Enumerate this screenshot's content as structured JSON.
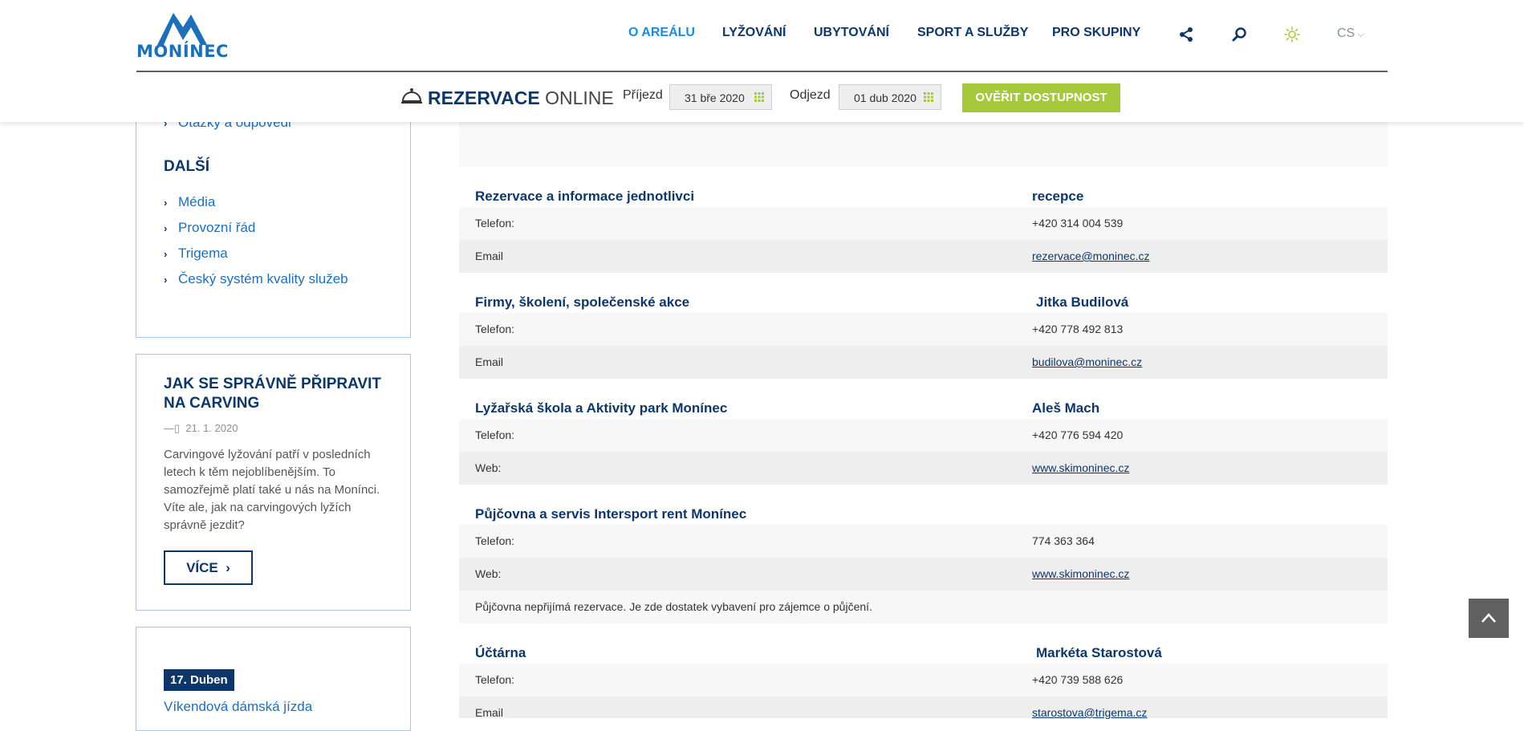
{
  "logo": {
    "text": "MONÍNEC"
  },
  "nav": {
    "items": [
      {
        "label": "O AREÁLU",
        "active": true
      },
      {
        "label": "LYŽOVÁNÍ"
      },
      {
        "label": "UBYTOVÁNÍ"
      },
      {
        "label": "SPORT A SLUŽBY"
      },
      {
        "label": "PRO SKUPINY"
      }
    ],
    "icons": [
      "share-icon",
      "search-icon",
      "sun-icon"
    ],
    "language": "CS"
  },
  "reservation": {
    "title_bold": "REZERVACE",
    "title_light": "ONLINE",
    "arrival_label": "Příjezd",
    "arrival_value": "31 bře 2020",
    "departure_label": "Odjezd",
    "departure_value": "01 dub 2020",
    "check_button": "OVĚŘIT DOSTUPNOST"
  },
  "sidebar": {
    "partial_link": "Otázky a odpovědi",
    "heading": "DALŠÍ",
    "links": [
      "Média",
      "Provozní řád",
      "Trigema",
      "Český systém kvality služeb"
    ],
    "article": {
      "title": "JAK SE SPRÁVNĚ PŘIPRAVIT NA CARVING",
      "date_prefix": "—▯",
      "date": "21. 1. 2020",
      "text": "Carvingové lyžování patří v posledních letech k těm nejoblíbenějším. To samozřejmě platí také u nás na Monínci. Víte ale, jak na carvingových lyžích správně jezdit?",
      "button": "VÍCE"
    },
    "event": {
      "badge": "17. Duben",
      "title": "Víkendová dámská jízda"
    }
  },
  "contacts": [
    {
      "title": "Rezervace a informace jednotlivci",
      "person": "recepce",
      "rows": [
        {
          "label": "Telefon:",
          "value": "+420 314 004 539"
        },
        {
          "label": "Email",
          "value": "rezervace@moninec.cz",
          "link": true
        }
      ]
    },
    {
      "title": "Firmy, školení, společenské akce",
      "person": "Jitka Budilová",
      "rows": [
        {
          "label": "Telefon:",
          "value": "+420 778 492 813"
        },
        {
          "label": "Email",
          "value": "budilova@moninec.cz",
          "link": true
        }
      ]
    },
    {
      "title": "Lyžařská škola a Aktivity park Monínec",
      "person": "Aleš Mach",
      "rows": [
        {
          "label": "Telefon:",
          "value": "+420 776 594 420"
        },
        {
          "label": "Web:",
          "value": "www.skimoninec.cz",
          "link": true
        }
      ]
    },
    {
      "title": "Půjčovna a servis Intersport rent Monínec",
      "person": "",
      "rows": [
        {
          "label": "Telefon:",
          "value": "774 363 364"
        },
        {
          "label": "Web:",
          "value": "www.skimoninec.cz",
          "link": true
        }
      ],
      "note": "Půjčovna nepřijímá rezervace. Je zde dostatek vybavení pro zájemce o půjčení."
    },
    {
      "title": "Účtárna",
      "person": "Markéta Starostová",
      "rows": [
        {
          "label": "Telefon:",
          "value": "+420 739 588 626"
        },
        {
          "label": "Email",
          "value": "starostova@trigema.cz",
          "link": true
        }
      ]
    }
  ],
  "colors": {
    "primary": "#0d3768",
    "link": "#1e6fb8",
    "active_nav": "#1e8bd8",
    "accent_green": "#a6c83d",
    "border_blue": "#a9c4e4"
  }
}
